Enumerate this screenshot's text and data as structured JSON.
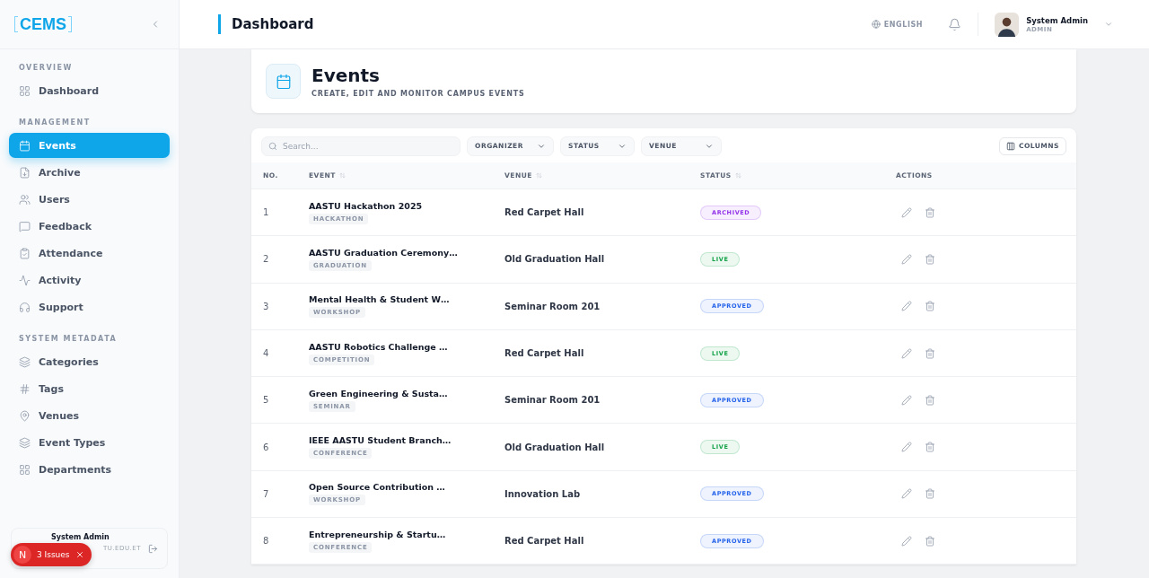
{
  "sidebar": {
    "logo": "CEMS",
    "sections": [
      {
        "title": "OVERVIEW",
        "items": [
          {
            "label": "Dashboard",
            "selected": false
          }
        ]
      },
      {
        "title": "MANAGEMENT",
        "items": [
          {
            "label": "Events",
            "selected": true
          },
          {
            "label": "Archive",
            "selected": false
          },
          {
            "label": "Users",
            "selected": false
          },
          {
            "label": "Feedback",
            "selected": false
          },
          {
            "label": "Attendance",
            "selected": false
          },
          {
            "label": "Activity",
            "selected": false
          },
          {
            "label": "Support",
            "selected": false
          }
        ]
      },
      {
        "title": "SYSTEM METADATA",
        "items": [
          {
            "label": "Categories",
            "selected": false
          },
          {
            "label": "Tags",
            "selected": false
          },
          {
            "label": "Venues",
            "selected": false
          },
          {
            "label": "Event Types",
            "selected": false
          },
          {
            "label": "Departments",
            "selected": false
          }
        ]
      }
    ],
    "user": {
      "name": "System Admin",
      "email": "TU.EDU.ET"
    }
  },
  "issues_badge": {
    "letter": "N",
    "label": "3 Issues"
  },
  "header": {
    "title": "Dashboard",
    "language": "ENGLISH",
    "user": {
      "name": "System Admin",
      "role": "ADMIN"
    }
  },
  "page": {
    "title": "Events",
    "subtitle": "CREATE, EDIT AND MONITOR CAMPUS EVENTS"
  },
  "toolbar": {
    "search": {
      "placeholder": "Search..."
    },
    "filters": [
      "ORGANIZER",
      "STATUS",
      "VENUE"
    ],
    "columns_button": "COLUMNS"
  },
  "table": {
    "columns": [
      {
        "label": "NO.",
        "sortable": false
      },
      {
        "label": "EVENT",
        "sortable": true
      },
      {
        "label": "VENUE",
        "sortable": true
      },
      {
        "label": "STATUS",
        "sortable": true
      },
      {
        "label": "ACTIONS",
        "sortable": false
      }
    ],
    "rows": [
      {
        "no": "1",
        "event": "AASTU Hackathon 2025",
        "type": "HACKATHON",
        "venue": "Red Carpet Hall",
        "status": {
          "label": "ARCHIVED",
          "color": "#9333ea"
        }
      },
      {
        "no": "2",
        "event": "AASTU Graduation Ceremony…",
        "type": "GRADUATION",
        "venue": "Old Graduation Hall",
        "status": {
          "label": "LIVE",
          "color": "#16a34a"
        }
      },
      {
        "no": "3",
        "event": "Mental Health & Student W…",
        "type": "WORKSHOP",
        "venue": "Seminar Room 201",
        "status": {
          "label": "APPROVED",
          "color": "#2563eb"
        }
      },
      {
        "no": "4",
        "event": "AASTU Robotics Challenge …",
        "type": "COMPETITION",
        "venue": "Red Carpet Hall",
        "status": {
          "label": "LIVE",
          "color": "#16a34a"
        }
      },
      {
        "no": "5",
        "event": "Green Engineering & Susta…",
        "type": "SEMINAR",
        "venue": "Seminar Room 201",
        "status": {
          "label": "APPROVED",
          "color": "#2563eb"
        }
      },
      {
        "no": "6",
        "event": "IEEE AASTU Student Branch…",
        "type": "CONFERENCE",
        "venue": "Old Graduation Hall",
        "status": {
          "label": "LIVE",
          "color": "#16a34a"
        }
      },
      {
        "no": "7",
        "event": "Open Source Contribution …",
        "type": "WORKSHOP",
        "venue": "Innovation Lab",
        "status": {
          "label": "APPROVED",
          "color": "#2563eb"
        }
      },
      {
        "no": "8",
        "event": "Entrepreneurship & Startu…",
        "type": "CONFERENCE",
        "venue": "Red Carpet Hall",
        "status": {
          "label": "APPROVED",
          "color": "#2563eb"
        }
      }
    ]
  }
}
